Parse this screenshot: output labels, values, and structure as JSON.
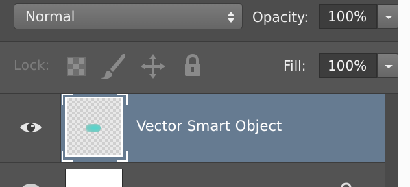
{
  "blend_mode": {
    "selected": "Normal"
  },
  "opacity": {
    "label": "Opacity:",
    "value": "100%"
  },
  "lock": {
    "label": "Lock:"
  },
  "fill": {
    "label": "Fill:",
    "value": "100%"
  },
  "layers": [
    {
      "name": "Vector Smart Object",
      "visible": true,
      "selected": true
    },
    {
      "name": "",
      "visible": true,
      "selected": false
    }
  ],
  "colors": {
    "panel_bg": "#535353",
    "selected_layer": "#667b91",
    "text": "#efefef",
    "lock_disabled": "#7c7c7c"
  },
  "icons": [
    "up-down-arrows-icon",
    "dropdown-triangle-icon",
    "lock-transparent-pixels-icon",
    "lock-image-pixels-icon",
    "lock-position-icon",
    "lock-all-icon",
    "eye-icon"
  ]
}
